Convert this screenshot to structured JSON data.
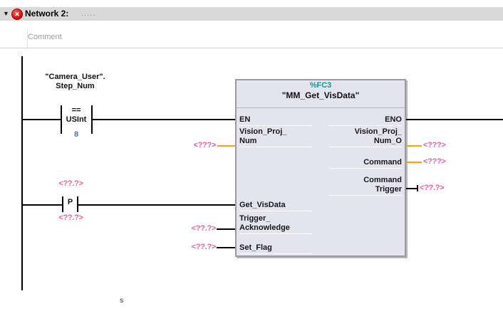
{
  "header": {
    "collapse_icon": "▼",
    "error_icon_glyph": "✕",
    "title": "Network 2:",
    "dots": ".....",
    "comment_placeholder": "Comment"
  },
  "rung1": {
    "operand_line1": "\"Camera_User\".",
    "operand_line2": "Step_Num",
    "operator": "==",
    "data_type": "USInt",
    "value": "8"
  },
  "rung2": {
    "operand_top": "<??.?>",
    "contact_label": "P",
    "operand_bottom": "<??.?>"
  },
  "block": {
    "address": "%FC3",
    "name": "\"MM_Get_VisData\"",
    "inputs": [
      {
        "line1": "EN"
      },
      {
        "line1": "Vision_Proj_",
        "line2": "Num",
        "operand": "<???>"
      },
      {
        "line1": "Get_VisData"
      },
      {
        "line1": "Trigger_",
        "line2": "Acknowledge",
        "operand": "<??.?>"
      },
      {
        "line1": "Set_Flag",
        "operand": "<??.?>"
      }
    ],
    "outputs": [
      {
        "line1": "ENO"
      },
      {
        "line1": "Vision_Proj_",
        "line2": "Num_O",
        "operand": "<???>"
      },
      {
        "line1": "Command",
        "operand": "<???>"
      },
      {
        "line1": "Command",
        "line2": "Trigger",
        "operand": "<??.?>"
      }
    ]
  },
  "colors": {
    "orange_wire": "#ffa000",
    "placeholder_pink": "#ee5f9e",
    "fc_teal": "#089c9c",
    "value_blue": "#4f6fd8",
    "error_red": "#cf0a0a",
    "block_fill": "#e4e4ee",
    "header_gray": "#d9d9d9"
  },
  "footer": {
    "stray_text": "s"
  }
}
